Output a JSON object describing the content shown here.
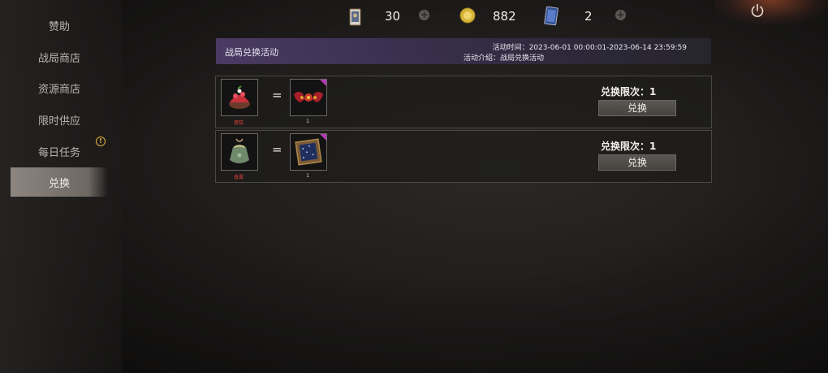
{
  "sidebar": {
    "items": [
      {
        "label": "赞助"
      },
      {
        "label": "战局商店"
      },
      {
        "label": "资源商店"
      },
      {
        "label": "限时供应"
      },
      {
        "label": "每日任务"
      },
      {
        "label": "兑换"
      }
    ],
    "active_index": 5
  },
  "resources": [
    {
      "icon": "card-icon",
      "value": "30"
    },
    {
      "icon": "gold-coin-icon",
      "value": "882"
    },
    {
      "icon": "blue-card-icon",
      "value": "2"
    }
  ],
  "activity": {
    "title": "战局兑换活动",
    "time": "活动时间：2023-06-01 00:00:01-2023-06-14 23:59:59",
    "description": "活动介绍：战局兑换活动"
  },
  "rows": [
    {
      "cost_item": {
        "icon": "cake-icon",
        "caption": "蛋糕"
      },
      "equals": "=",
      "reward_item": {
        "icon": "bat-decoration-icon",
        "count": "1"
      },
      "limit_text": "兑换限次：1",
      "button_label": "兑换"
    },
    {
      "cost_item": {
        "icon": "pouch-icon",
        "caption": "香囊"
      },
      "equals": "=",
      "reward_item": {
        "icon": "star-map-frame-icon",
        "count": "1"
      },
      "limit_text": "兑换限次：1",
      "button_label": "兑换"
    }
  ],
  "colors": {
    "accent_purple": "#4a3a63",
    "corner_tag": "#b33ab0",
    "caption_red": "#d03d35",
    "alert_yellow": "#e3b53b"
  }
}
